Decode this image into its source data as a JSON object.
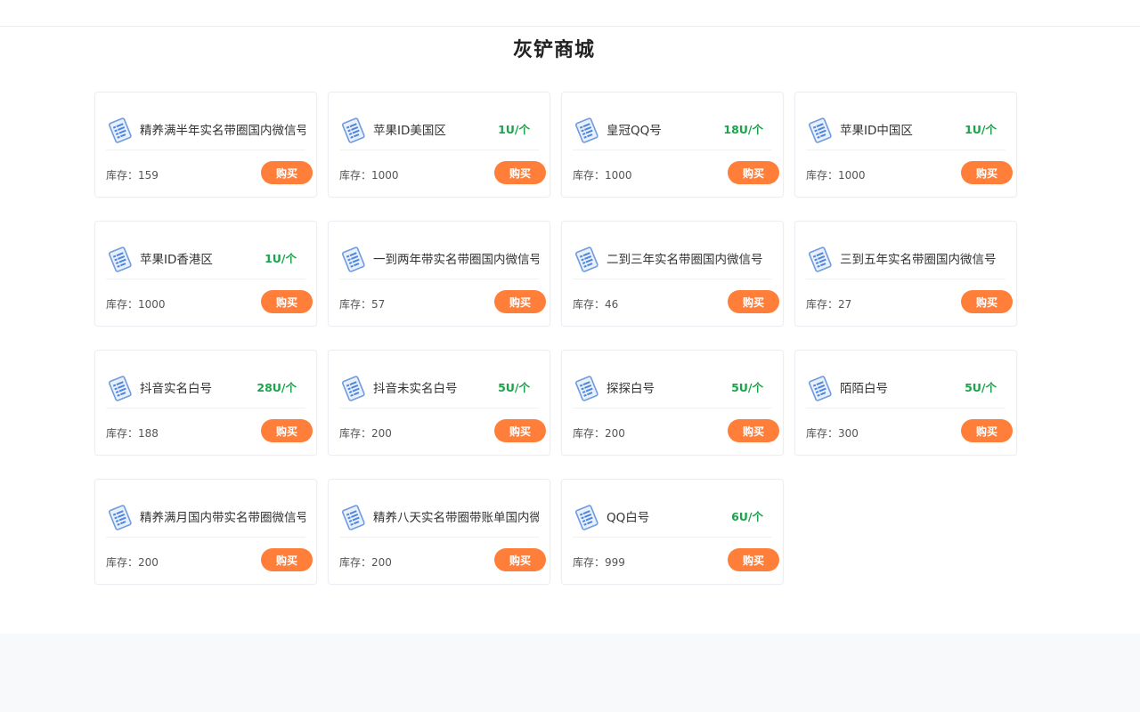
{
  "page": {
    "title": "灰铲商城"
  },
  "stock_label": "库存：",
  "buy_label": "购买",
  "icon": "document-list-icon",
  "colors": {
    "price": "#1aa34a",
    "button": "#ff7f3a"
  },
  "products": [
    {
      "name": "精养满半年实名带圈国内微信号",
      "price": "",
      "stock": "159"
    },
    {
      "name": "苹果ID美国区",
      "price": "1U/个",
      "stock": "1000"
    },
    {
      "name": "皇冠QQ号",
      "price": "18U/个",
      "stock": "1000"
    },
    {
      "name": "苹果ID中国区",
      "price": "1U/个",
      "stock": "1000"
    },
    {
      "name": "苹果ID香港区",
      "price": "1U/个",
      "stock": "1000"
    },
    {
      "name": "一到两年带实名带圈国内微信号",
      "price": "",
      "stock": "57"
    },
    {
      "name": "二到三年实名带圈国内微信号",
      "price": "",
      "stock": "46"
    },
    {
      "name": "三到五年实名带圈国内微信号",
      "price": "",
      "stock": "27"
    },
    {
      "name": "抖音实名白号",
      "price": "28U/个",
      "stock": "188"
    },
    {
      "name": "抖音未实名白号",
      "price": "5U/个",
      "stock": "200"
    },
    {
      "name": "探探白号",
      "price": "5U/个",
      "stock": "200"
    },
    {
      "name": "陌陌白号",
      "price": "5U/个",
      "stock": "300"
    },
    {
      "name": "精养满月国内带实名带圈微信号",
      "price": "",
      "stock": "200"
    },
    {
      "name": "精养八天实名带圈带账单国内微信号",
      "price": "",
      "stock": "200"
    },
    {
      "name": "QQ白号",
      "price": "6U/个",
      "stock": "999"
    }
  ]
}
